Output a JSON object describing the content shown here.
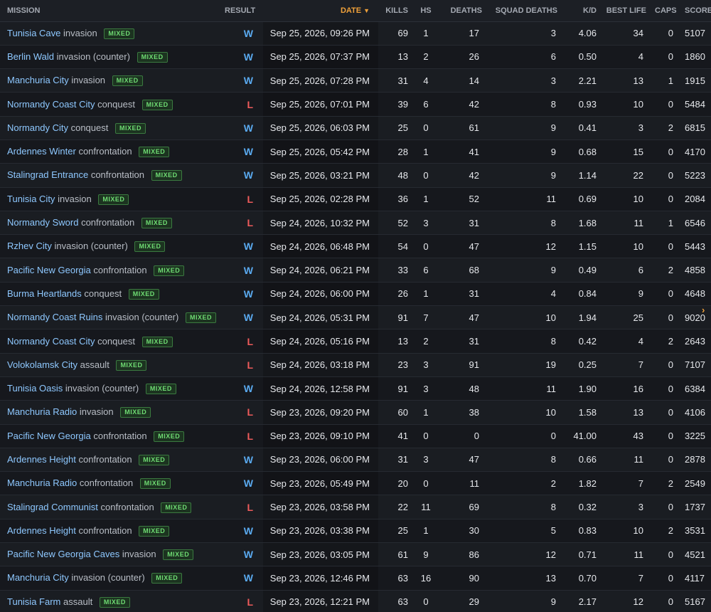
{
  "columns": {
    "mission": "MISSION",
    "result": "RESULT",
    "date": "DATE",
    "sort_arrow": "▼",
    "kills": "KILLS",
    "hs": "HS",
    "deaths": "DEATHS",
    "squad_deaths": "SQUAD DEATHS",
    "kd": "K/D",
    "best_life": "BEST LIFE",
    "caps": "CAPS",
    "score": "SCORE"
  },
  "badge_label": "MIXED",
  "scroll_indicator": "›",
  "colors": {
    "win": "#5aaaf0",
    "loss": "#ef5b5b",
    "map_link": "#8ec8ff",
    "badge_text": "#6fdc73",
    "sort_accent": "#f0a13a"
  },
  "rows": [
    {
      "map": "Tunisia Cave",
      "mode": "invasion",
      "badge": "MIXED",
      "result": "W",
      "date": "Sep 25, 2026, 09:26 PM",
      "kills": "69",
      "hs": "1",
      "deaths": "17",
      "squad_deaths": "3",
      "kd": "4.06",
      "best_life": "34",
      "caps": "0",
      "score": "5107"
    },
    {
      "map": "Berlin Wald",
      "mode": "invasion (counter)",
      "badge": "MIXED",
      "result": "W",
      "date": "Sep 25, 2026, 07:37 PM",
      "kills": "13",
      "hs": "2",
      "deaths": "26",
      "squad_deaths": "6",
      "kd": "0.50",
      "best_life": "4",
      "caps": "0",
      "score": "1860"
    },
    {
      "map": "Manchuria City",
      "mode": "invasion",
      "badge": "MIXED",
      "result": "W",
      "date": "Sep 25, 2026, 07:28 PM",
      "kills": "31",
      "hs": "4",
      "deaths": "14",
      "squad_deaths": "3",
      "kd": "2.21",
      "best_life": "13",
      "caps": "1",
      "score": "1915"
    },
    {
      "map": "Normandy Coast City",
      "mode": "conquest",
      "badge": "MIXED",
      "result": "L",
      "date": "Sep 25, 2026, 07:01 PM",
      "kills": "39",
      "hs": "6",
      "deaths": "42",
      "squad_deaths": "8",
      "kd": "0.93",
      "best_life": "10",
      "caps": "0",
      "score": "5484"
    },
    {
      "map": "Normandy City",
      "mode": "conquest",
      "badge": "MIXED",
      "result": "W",
      "date": "Sep 25, 2026, 06:03 PM",
      "kills": "25",
      "hs": "0",
      "deaths": "61",
      "squad_deaths": "9",
      "kd": "0.41",
      "best_life": "3",
      "caps": "2",
      "score": "6815"
    },
    {
      "map": "Ardennes Winter",
      "mode": "confrontation",
      "badge": "MIXED",
      "result": "W",
      "date": "Sep 25, 2026, 05:42 PM",
      "kills": "28",
      "hs": "1",
      "deaths": "41",
      "squad_deaths": "9",
      "kd": "0.68",
      "best_life": "15",
      "caps": "0",
      "score": "4170"
    },
    {
      "map": "Stalingrad Entrance",
      "mode": "confrontation",
      "badge": "MIXED",
      "result": "W",
      "date": "Sep 25, 2026, 03:21 PM",
      "kills": "48",
      "hs": "0",
      "deaths": "42",
      "squad_deaths": "9",
      "kd": "1.14",
      "best_life": "22",
      "caps": "0",
      "score": "5223"
    },
    {
      "map": "Tunisia City",
      "mode": "invasion",
      "badge": "MIXED",
      "result": "L",
      "date": "Sep 25, 2026, 02:28 PM",
      "kills": "36",
      "hs": "1",
      "deaths": "52",
      "squad_deaths": "11",
      "kd": "0.69",
      "best_life": "10",
      "caps": "0",
      "score": "2084"
    },
    {
      "map": "Normandy Sword",
      "mode": "confrontation",
      "badge": "MIXED",
      "result": "L",
      "date": "Sep 24, 2026, 10:32 PM",
      "kills": "52",
      "hs": "3",
      "deaths": "31",
      "squad_deaths": "8",
      "kd": "1.68",
      "best_life": "11",
      "caps": "1",
      "score": "6546"
    },
    {
      "map": "Rzhev City",
      "mode": "invasion (counter)",
      "badge": "MIXED",
      "result": "W",
      "date": "Sep 24, 2026, 06:48 PM",
      "kills": "54",
      "hs": "0",
      "deaths": "47",
      "squad_deaths": "12",
      "kd": "1.15",
      "best_life": "10",
      "caps": "0",
      "score": "5443"
    },
    {
      "map": "Pacific New Georgia",
      "mode": "confrontation",
      "badge": "MIXED",
      "result": "W",
      "date": "Sep 24, 2026, 06:21 PM",
      "kills": "33",
      "hs": "6",
      "deaths": "68",
      "squad_deaths": "9",
      "kd": "0.49",
      "best_life": "6",
      "caps": "2",
      "score": "4858"
    },
    {
      "map": "Burma Heartlands",
      "mode": "conquest",
      "badge": "MIXED",
      "result": "W",
      "date": "Sep 24, 2026, 06:00 PM",
      "kills": "26",
      "hs": "1",
      "deaths": "31",
      "squad_deaths": "4",
      "kd": "0.84",
      "best_life": "9",
      "caps": "0",
      "score": "4648"
    },
    {
      "map": "Normandy Coast Ruins",
      "mode": "invasion (counter)",
      "badge": "MIXED",
      "result": "W",
      "date": "Sep 24, 2026, 05:31 PM",
      "kills": "91",
      "hs": "7",
      "deaths": "47",
      "squad_deaths": "10",
      "kd": "1.94",
      "best_life": "25",
      "caps": "0",
      "score": "9020"
    },
    {
      "map": "Normandy Coast City",
      "mode": "conquest",
      "badge": "MIXED",
      "result": "L",
      "date": "Sep 24, 2026, 05:16 PM",
      "kills": "13",
      "hs": "2",
      "deaths": "31",
      "squad_deaths": "8",
      "kd": "0.42",
      "best_life": "4",
      "caps": "2",
      "score": "2643"
    },
    {
      "map": "Volokolamsk City",
      "mode": "assault",
      "badge": "MIXED",
      "result": "L",
      "date": "Sep 24, 2026, 03:18 PM",
      "kills": "23",
      "hs": "3",
      "deaths": "91",
      "squad_deaths": "19",
      "kd": "0.25",
      "best_life": "7",
      "caps": "0",
      "score": "7107"
    },
    {
      "map": "Tunisia Oasis",
      "mode": "invasion (counter)",
      "badge": "MIXED",
      "result": "W",
      "date": "Sep 24, 2026, 12:58 PM",
      "kills": "91",
      "hs": "3",
      "deaths": "48",
      "squad_deaths": "11",
      "kd": "1.90",
      "best_life": "16",
      "caps": "0",
      "score": "6384"
    },
    {
      "map": "Manchuria Radio",
      "mode": "invasion",
      "badge": "MIXED",
      "result": "L",
      "date": "Sep 23, 2026, 09:20 PM",
      "kills": "60",
      "hs": "1",
      "deaths": "38",
      "squad_deaths": "10",
      "kd": "1.58",
      "best_life": "13",
      "caps": "0",
      "score": "4106"
    },
    {
      "map": "Pacific New Georgia",
      "mode": "confrontation",
      "badge": "MIXED",
      "result": "L",
      "date": "Sep 23, 2026, 09:10 PM",
      "kills": "41",
      "hs": "0",
      "deaths": "0",
      "squad_deaths": "0",
      "kd": "41.00",
      "best_life": "43",
      "caps": "0",
      "score": "3225"
    },
    {
      "map": "Ardennes Height",
      "mode": "confrontation",
      "badge": "MIXED",
      "result": "W",
      "date": "Sep 23, 2026, 06:00 PM",
      "kills": "31",
      "hs": "3",
      "deaths": "47",
      "squad_deaths": "8",
      "kd": "0.66",
      "best_life": "11",
      "caps": "0",
      "score": "2878"
    },
    {
      "map": "Manchuria Radio",
      "mode": "confrontation",
      "badge": "MIXED",
      "result": "W",
      "date": "Sep 23, 2026, 05:49 PM",
      "kills": "20",
      "hs": "0",
      "deaths": "11",
      "squad_deaths": "2",
      "kd": "1.82",
      "best_life": "7",
      "caps": "2",
      "score": "2549"
    },
    {
      "map": "Stalingrad Communist",
      "mode": "confrontation",
      "badge": "MIXED",
      "result": "L",
      "date": "Sep 23, 2026, 03:58 PM",
      "kills": "22",
      "hs": "11",
      "deaths": "69",
      "squad_deaths": "8",
      "kd": "0.32",
      "best_life": "3",
      "caps": "0",
      "score": "1737"
    },
    {
      "map": "Ardennes Height",
      "mode": "confrontation",
      "badge": "MIXED",
      "result": "W",
      "date": "Sep 23, 2026, 03:38 PM",
      "kills": "25",
      "hs": "1",
      "deaths": "30",
      "squad_deaths": "5",
      "kd": "0.83",
      "best_life": "10",
      "caps": "2",
      "score": "3531"
    },
    {
      "map": "Pacific New Georgia Caves",
      "mode": "invasion",
      "badge": "MIXED",
      "result": "W",
      "date": "Sep 23, 2026, 03:05 PM",
      "kills": "61",
      "hs": "9",
      "deaths": "86",
      "squad_deaths": "12",
      "kd": "0.71",
      "best_life": "11",
      "caps": "0",
      "score": "4521"
    },
    {
      "map": "Manchuria City",
      "mode": "invasion (counter)",
      "badge": "MIXED",
      "result": "W",
      "date": "Sep 23, 2026, 12:46 PM",
      "kills": "63",
      "hs": "16",
      "deaths": "90",
      "squad_deaths": "13",
      "kd": "0.70",
      "best_life": "7",
      "caps": "0",
      "score": "4117"
    },
    {
      "map": "Tunisia Farm",
      "mode": "assault",
      "badge": "MIXED",
      "result": "L",
      "date": "Sep 23, 2026, 12:21 PM",
      "kills": "63",
      "hs": "0",
      "deaths": "29",
      "squad_deaths": "9",
      "kd": "2.17",
      "best_life": "12",
      "caps": "0",
      "score": "5167"
    }
  ]
}
